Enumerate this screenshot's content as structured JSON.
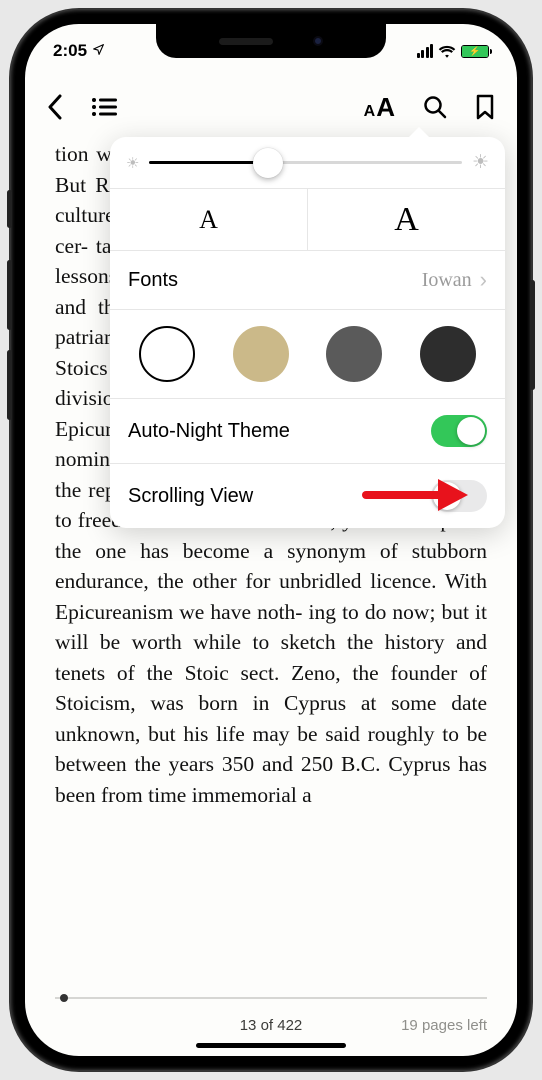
{
  "status": {
    "time": "2:05",
    "location_arrow": "➤"
  },
  "toolbar": {
    "back": "‹",
    "toc": "☰",
    "aa_small": "A",
    "aa_big": "A"
  },
  "popover": {
    "font_decrease": "A",
    "font_increase": "A",
    "fonts_label": "Fonts",
    "fonts_value": "Iowan",
    "auto_night_label": "Auto-Night Theme",
    "auto_night_on": true,
    "scrolling_label": "Scrolling View",
    "scrolling_on": false,
    "theme_colors": {
      "white": "#ffffff",
      "sepia": "#cbb989",
      "gray": "#5a5a5a",
      "black": "#2d2d2d"
    }
  },
  "book_text": "tion was compatible with high imperial position. But Rome on the whole kept aloof from Greek culture; a fact of which Cicero afforded indirect cer- tainty to the strength of the Greek grammar lessons he learned always or with unwillingness, and there were Greek schools handled by the patriarchs. It is among the Greeks almost that the Stoics emerge alongside the two precedent divisions of philosophy — Stoicism and Epicureanism. The ideal set before each was nominally much the same. The Stoics aspired to the repression of all emotion, and the Epicureans to freedom from all disturbance; yet in the upshot the one has become a synonym of stubborn endurance, the other for unbridled licence. With Epicureanism we have noth- ing to do now; but it will be worth while to sketch the history and tenets of the Stoic sect. Zeno, the founder of Stoicism, was born in Cyprus at some date unknown, but his life may be said roughly to be between the years 350 and 250 B.C. Cyprus has been from time immemorial a",
  "footer": {
    "page_of": "13 of 422",
    "pages_left": "19 pages left"
  }
}
